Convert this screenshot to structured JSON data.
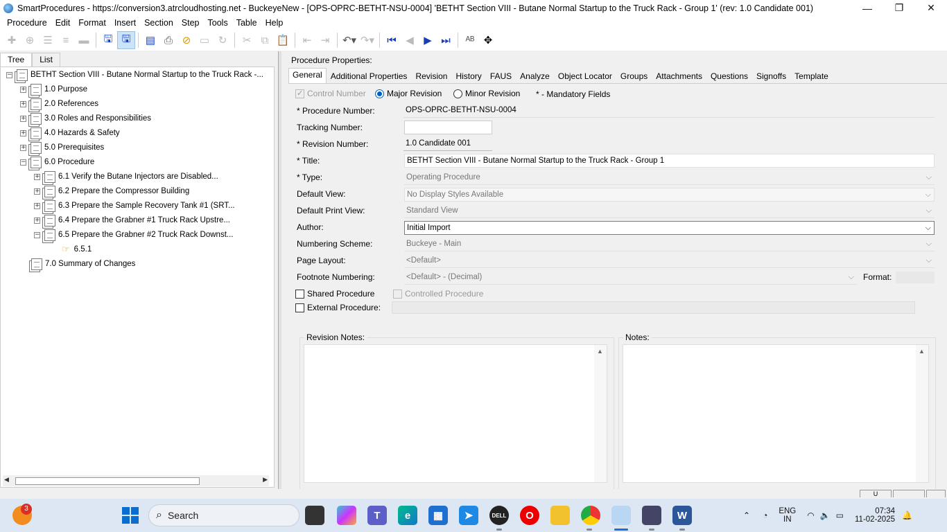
{
  "window": {
    "title": "SmartProcedures - https://conversion3.atrcloudhosting.net - BuckeyeNew - [OPS-OPRC-BETHT-NSU-0004] 'BETHT Section VIII - Butane Normal Startup to the Truck Rack - Group 1' (rev: 1.0 Candidate 001)",
    "minimize": "—",
    "restore": "❐",
    "close": "✕"
  },
  "menu": [
    "Procedure",
    "Edit",
    "Format",
    "Insert",
    "Section",
    "Step",
    "Tools",
    "Table",
    "Help"
  ],
  "toolbar_icons": [
    "add-icon",
    "add-child-icon",
    "list-icon",
    "list-indent-icon",
    "remove-icon",
    "save-icon",
    "save-all-icon",
    "publish-icon",
    "print-icon",
    "link-icon",
    "frame-icon",
    "refresh-icon",
    "cut-icon",
    "copy-icon",
    "paste-icon",
    "outdent-icon",
    "indent-icon",
    "undo-icon",
    "redo-icon",
    "first-icon",
    "previous-icon",
    "next-icon",
    "last-icon",
    "spell-icon",
    "move-icon"
  ],
  "left_tabs": [
    "Tree",
    "List"
  ],
  "tree": [
    {
      "label": "BETHT Section VIII - Butane Normal Startup to the Truck Rack -...",
      "expander": "−",
      "level": 0
    },
    {
      "label": "1.0 Purpose",
      "expander": "+",
      "level": 1
    },
    {
      "label": "2.0 References",
      "expander": "+",
      "level": 1
    },
    {
      "label": "3.0 Roles and Responsibilities",
      "expander": "+",
      "level": 1
    },
    {
      "label": "4.0 Hazards & Safety",
      "expander": "+",
      "level": 1
    },
    {
      "label": "5.0 Prerequisites",
      "expander": "+",
      "level": 1
    },
    {
      "label": "6.0 Procedure",
      "expander": "−",
      "level": 1
    },
    {
      "label": "6.1 Verify the Butane Injectors are Disabled...",
      "expander": "+",
      "level": 2
    },
    {
      "label": "6.2 Prepare the Compressor Building",
      "expander": "+",
      "level": 2
    },
    {
      "label": "6.3 Prepare the Sample Recovery Tank #1 (SRT...",
      "expander": "+",
      "level": 2
    },
    {
      "label": "6.4 Prepare the Grabner #1 Truck Rack Upstre...",
      "expander": "+",
      "level": 2
    },
    {
      "label": "6.5 Prepare the Grabner #2 Truck Rack Downst...",
      "expander": "−",
      "level": 2
    },
    {
      "label": "6.5.1",
      "expander": "",
      "level": 3
    },
    {
      "label": "7.0 Summary of Changes",
      "expander": "",
      "level": 1
    }
  ],
  "right": {
    "heading": "Procedure Properties:",
    "tabs": [
      "General",
      "Additional Properties",
      "Revision",
      "History",
      "FAUS",
      "Analyze",
      "Object Locator",
      "Groups",
      "Attachments",
      "Questions",
      "Signoffs",
      "Template"
    ],
    "control_number": "Control Number",
    "major_revision": "Major Revision",
    "minor_revision": "Minor Revision",
    "mandatory": "* - Mandatory Fields",
    "fields": {
      "procedure_number_label": "* Procedure Number:",
      "procedure_number": "OPS-OPRC-BETHT-NSU-0004",
      "tracking_number_label": "Tracking Number:",
      "tracking_number": "",
      "revision_number_label": "* Revision Number:",
      "revision_number": "1.0 Candidate 001",
      "title_label": "* Title:",
      "title": "BETHT Section VIII - Butane Normal Startup to the Truck Rack - Group 1",
      "type_label": "* Type:",
      "type": "Operating Procedure",
      "default_view_label": "Default View:",
      "default_view": "No Display Styles Available",
      "default_print_view_label": "Default Print View:",
      "default_print_view": "Standard View",
      "author_label": "Author:",
      "author": "Initial Import",
      "numbering_scheme_label": "Numbering Scheme:",
      "numbering_scheme": "Buckeye - Main",
      "page_layout_label": "Page Layout:",
      "page_layout": "<Default>",
      "footnote_numbering_label": "Footnote Numbering:",
      "footnote_numbering": "<Default> - (Decimal)",
      "format_label": "Format:",
      "shared_procedure": "Shared Procedure",
      "controlled_procedure": "Controlled Procedure",
      "external_procedure": "External Procedure:"
    },
    "revision_notes_label": "Revision Notes:",
    "notes_label": "Notes:"
  },
  "statusbar": {
    "box1": "U"
  },
  "taskbar": {
    "notification_count": "3",
    "search_placeholder": "Search",
    "lang_line1": "ENG",
    "lang_line2": "IN",
    "time": "07:34",
    "date": "11-02-2025"
  }
}
